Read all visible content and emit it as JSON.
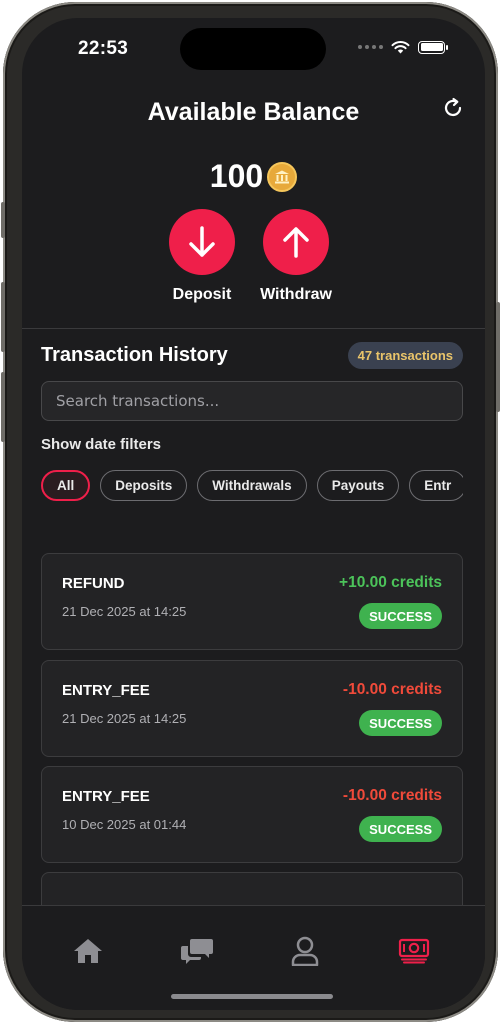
{
  "status_bar": {
    "time": "22:53"
  },
  "header": {
    "title": "Available Balance"
  },
  "balance": {
    "value": "100"
  },
  "actions": {
    "deposit_label": "Deposit",
    "withdraw_label": "Withdraw"
  },
  "history": {
    "title": "Transaction History",
    "count_label": "47 transactions",
    "search_placeholder": "Search transactions...",
    "date_filters_label": "Show date filters",
    "filters": [
      "All",
      "Deposits",
      "Withdrawals",
      "Payouts",
      "Entr"
    ],
    "transactions": [
      {
        "type": "REFUND",
        "date": "21 Dec 2025 at 14:25",
        "amount": "+10.00 credits",
        "status": "SUCCESS"
      },
      {
        "type": "ENTRY_FEE",
        "date": "21 Dec 2025 at 14:25",
        "amount": "-10.00 credits",
        "status": "SUCCESS"
      },
      {
        "type": "ENTRY_FEE",
        "date": "10 Dec 2025 at 01:44",
        "amount": "-10.00 credits",
        "status": "SUCCESS"
      }
    ]
  },
  "colors": {
    "accent": "#ef1f4a",
    "positive": "#4cc35a",
    "negative": "#f04a3a",
    "success_badge": "#3fb24f",
    "count_badge_text": "#e9c46a"
  },
  "tabs": [
    {
      "icon": "home-icon"
    },
    {
      "icon": "chat-icon"
    },
    {
      "icon": "profile-icon"
    },
    {
      "icon": "wallet-icon",
      "active": true
    }
  ]
}
